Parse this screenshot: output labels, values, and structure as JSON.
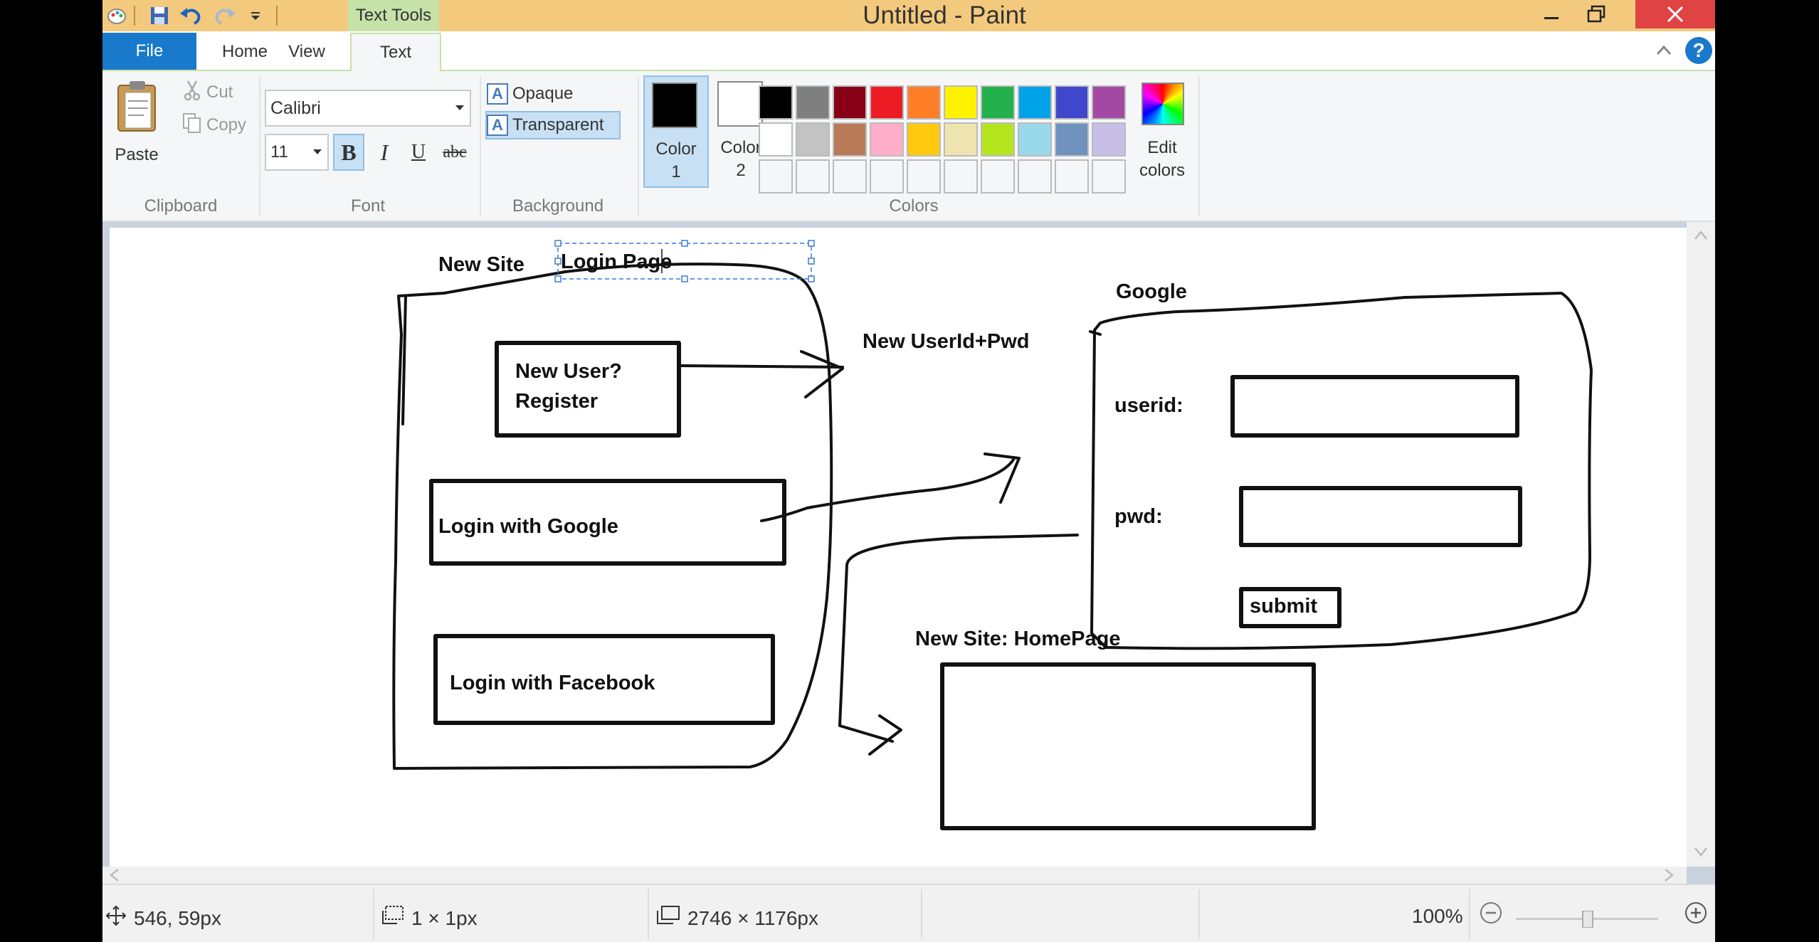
{
  "window": {
    "title": "Untitled - Paint",
    "context_tab": "Text Tools"
  },
  "tabs": {
    "file": "File",
    "home": "Home",
    "view": "View",
    "text": "Text"
  },
  "ribbon": {
    "clipboard": {
      "group": "Clipboard",
      "paste": "Paste",
      "cut": "Cut",
      "copy": "Copy"
    },
    "font": {
      "group": "Font",
      "family": "Calibri",
      "size": "11",
      "bold": "B",
      "italic": "I",
      "underline": "U",
      "strikethrough": "abc"
    },
    "background": {
      "group": "Background",
      "opaque": "Opaque",
      "transparent": "Transparent",
      "icon_letter": "A"
    },
    "colors": {
      "group": "Colors",
      "color1_line1": "Color",
      "color1_line2": "1",
      "color2_line1": "Color",
      "color2_line2": "2",
      "edit_line1": "Edit",
      "edit_line2": "colors",
      "color1_value": "#000000",
      "color2_value": "#ffffff",
      "palette": [
        "#000000",
        "#7f7f7f",
        "#880015",
        "#ed1c24",
        "#ff7f27",
        "#fff200",
        "#22b14c",
        "#00a2e8",
        "#3f48cc",
        "#a349a4",
        "#ffffff",
        "#c3c3c3",
        "#b97a57",
        "#ffaec9",
        "#ffc90e",
        "#efe4b0",
        "#b5e61d",
        "#99d9ea",
        "#7092be",
        "#c8bfe7"
      ]
    }
  },
  "canvas_text": {
    "new_site": "New Site",
    "login_page": "Login Page",
    "new_user_line1": "New User?",
    "new_user_line2": "Register",
    "login_google": "Login with Google",
    "login_facebook": "Login with Facebook",
    "new_userid_pwd": "New UserId+Pwd",
    "google": "Google",
    "userid": "userid:",
    "pwd": "pwd:",
    "submit": "submit",
    "homepage": "New Site: HomePage"
  },
  "status": {
    "cursor_pos": "546, 59px",
    "selection_size": "1 × 1px",
    "image_size": "2746 × 1176px",
    "zoom": "100%"
  },
  "icons": [
    "paint-menu-icon",
    "save-icon",
    "undo-icon",
    "redo-icon",
    "customize-qat-icon",
    "minimize-icon",
    "maximize-icon",
    "close-icon",
    "ribbon-collapse-icon",
    "help-icon",
    "paste-icon",
    "cut-icon",
    "copy-icon",
    "cursor-move-icon",
    "selection-icon",
    "canvas-size-icon",
    "zoom-out-icon",
    "zoom-in-icon"
  ]
}
